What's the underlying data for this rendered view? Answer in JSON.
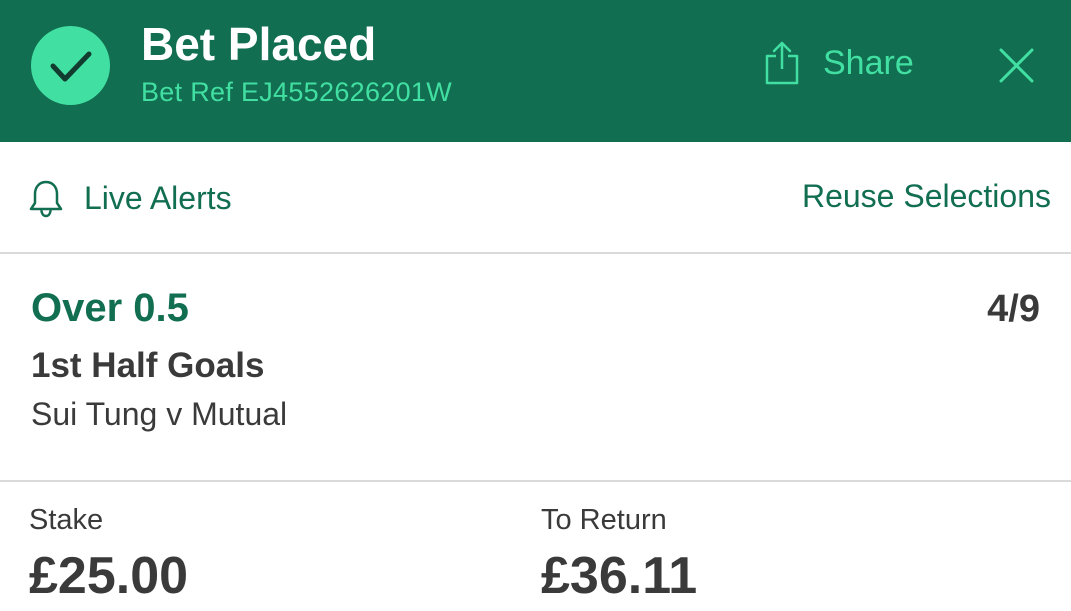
{
  "header": {
    "title": "Bet Placed",
    "bet_ref": "Bet Ref EJ4552626201W",
    "share_label": "Share",
    "icons": [
      "checkmark-icon",
      "share-icon",
      "close-icon"
    ]
  },
  "actions": {
    "live_alerts_label": "Live Alerts",
    "reuse_label": "Reuse Selections",
    "icons": [
      "bell-icon"
    ]
  },
  "selection": {
    "name": "Over 0.5",
    "odds": "4/9",
    "market": "1st Half Goals",
    "event": "Sui Tung v Mutual"
  },
  "summary": {
    "stake_label": "Stake",
    "stake_value": "£25.00",
    "return_label": "To Return",
    "return_value": "£36.11"
  },
  "colors": {
    "brand_green": "#126e51",
    "accent_mint": "#41e0a2",
    "text_dark": "#3a3a3a",
    "divider": "#dadada"
  }
}
